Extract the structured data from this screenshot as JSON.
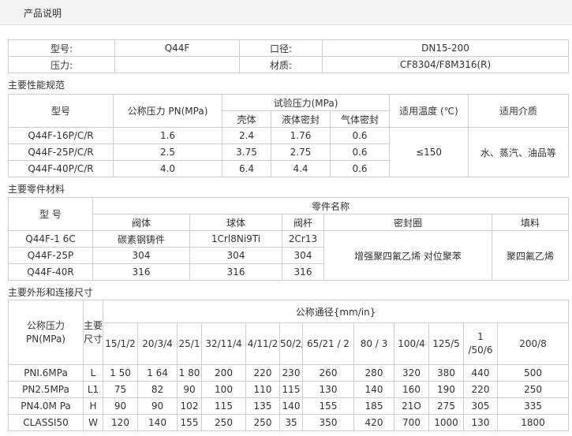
{
  "header": {
    "title": "产品说明"
  },
  "basic": {
    "model_label": "型号:",
    "model_value": "Q44F",
    "diameter_label": "口径:",
    "diameter_value": "DN15-200",
    "pressure_label": "压力:",
    "pressure_value": "",
    "material_label": "材质:",
    "material_value": "CF8304/F8M316(R)"
  },
  "performance": {
    "title": "主要性能规范",
    "h_model": "型号",
    "h_pn": "公称压力 PN(MPa)",
    "h_test": "试验压力(MPa)",
    "h_shell": "壳体",
    "h_liquid": "液体密封",
    "h_gas": "气体密封",
    "h_temp": "适用温度 (℃)",
    "h_medium": "适用介质",
    "rows": [
      {
        "model": "Q44F-16P/C/R",
        "pn": "1.6",
        "shell": "2.4",
        "liquid": "1.76",
        "gas": "0.6"
      },
      {
        "model": "Q44F-25P/C/R",
        "pn": "2.5",
        "shell": "3.75",
        "liquid": "2.75",
        "gas": "0.6"
      },
      {
        "model": "Q44F-40P/C/R",
        "pn": "4.0",
        "shell": "6.4",
        "liquid": "4.4",
        "gas": "0.6"
      }
    ],
    "temp": "≤150",
    "medium": "水、蒸汽、油品等"
  },
  "materials": {
    "title": "主要零件材料",
    "h_model": "型 号",
    "h_parts": "零件名称",
    "h_body": "阀体",
    "h_ball": "球体",
    "h_stem": "阀杆",
    "h_seal": "密封圈",
    "h_packing": "填料",
    "rows": [
      {
        "model": "Q44F-1 6C",
        "body": "碳素钢铸件",
        "ball": "1Crl8Ni9Ti",
        "stem": "2Cr13"
      },
      {
        "model": "Q44F-25P",
        "body": "304",
        "ball": "304",
        "stem": "304"
      },
      {
        "model": "Q44F-40R",
        "body": "316",
        "ball": "316",
        "stem": "316"
      }
    ],
    "seal": "增强聚四氟乙烯 对位聚苯",
    "packing": "聚四氟乙烯"
  },
  "dimensions": {
    "title": "主要外形和连接尺寸",
    "h_pn": "公称压力PN(MPa)",
    "h_main": "主要尺寸",
    "h_dn": "公称通径{mm/in}",
    "columns": [
      "15/1/2",
      "20/3/4",
      "25/1",
      "32/11/4",
      "4/11/2",
      "50/2/",
      "65/21 / 2",
      "80 / 3",
      "100/4",
      "125/5",
      "1 /50/6",
      "200/8"
    ],
    "rows": [
      {
        "pn": "PNI.6MPa",
        "dim": "L",
        "values": [
          "1 50",
          "1 64",
          "1 80",
          "200",
          "220",
          "230",
          "260",
          "280",
          "320",
          "380",
          "440",
          "500"
        ]
      },
      {
        "pn": "PN2.5MPa",
        "dim": "L1",
        "values": [
          "75",
          "82",
          "90",
          "100",
          "110",
          "115",
          "130",
          "140",
          "160",
          "190",
          "220",
          "250"
        ]
      },
      {
        "pn": "PN4.0M Pa",
        "dim": "H",
        "values": [
          "90",
          "90",
          "102",
          "115",
          "135",
          "140",
          "155",
          "185",
          "21O",
          "275",
          "305",
          "335"
        ]
      },
      {
        "pn": "CLASSI50",
        "dim": "W",
        "values": [
          "120",
          "140",
          "155",
          "250",
          "250",
          "35",
          "350",
          "420",
          "700",
          "1000",
          "130",
          "1800"
        ]
      }
    ]
  }
}
